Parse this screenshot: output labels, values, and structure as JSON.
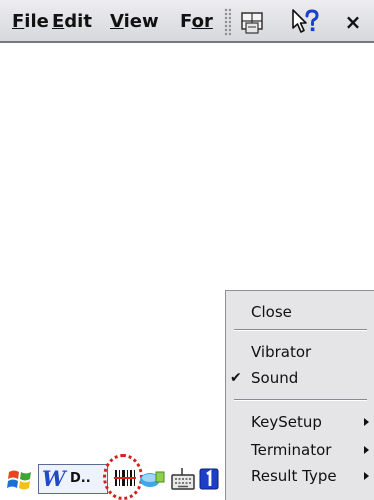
{
  "menubar": {
    "items": [
      {
        "label": "File",
        "mnemonic": "F",
        "rest": "ile"
      },
      {
        "label": "Edit",
        "mnemonic": "E",
        "rest": "dit"
      },
      {
        "label": "View",
        "mnemonic": "V",
        "rest": "iew"
      },
      {
        "label": "For",
        "mnemonic": "F",
        "rest": "or"
      }
    ],
    "toolbar_icons": [
      "input-panel-icon",
      "whats-this-help-icon",
      "close-icon"
    ],
    "close_glyph": "×"
  },
  "context_menu": {
    "items": [
      {
        "label": "Close",
        "checked": false,
        "submenu": false
      },
      {
        "label": "Vibrator",
        "checked": false,
        "submenu": false
      },
      {
        "label": "Sound",
        "checked": true,
        "submenu": false
      },
      {
        "label": "KeySetup",
        "checked": false,
        "submenu": true
      },
      {
        "label": "Terminator",
        "checked": false,
        "submenu": true
      },
      {
        "label": "Result Type",
        "checked": false,
        "submenu": true
      }
    ],
    "check_glyph": "✔"
  },
  "taskbar": {
    "word_button": {
      "letter": "W",
      "text": "D.."
    },
    "icons": [
      "windows-flag-icon",
      "word-icon",
      "barcode-scanner-icon",
      "connectivity-icon",
      "keyboard-icon",
      "input-mode-1-icon"
    ],
    "input_indicator": "1"
  },
  "colors": {
    "highlight_ring": "#d62020",
    "menubar_bg": "#dcdde2",
    "context_menu_bg": "#e5e5e8"
  }
}
